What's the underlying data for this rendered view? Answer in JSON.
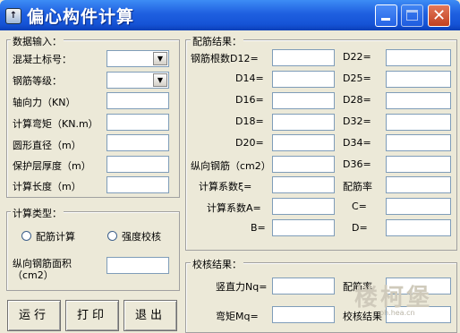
{
  "window": {
    "title": "偏心构件计算",
    "icon": "app-icon"
  },
  "input": {
    "legend": "数据输入：",
    "concrete_label": "混凝土标号：",
    "steel_label": "钢筋等级：",
    "axial_label": "轴向力（KN）",
    "moment_label": "计算弯矩（KN.m）",
    "diameter_label": "圆形直径（m）",
    "cover_label": "保护层厚度（m）",
    "length_label": "计算长度（m）"
  },
  "calc_type": {
    "legend": "计算类型：",
    "option1": "配筋计算",
    "option2": "强度校核",
    "area_label_1": "纵向钢筋面积",
    "area_label_2": "（cm2）"
  },
  "rebar": {
    "legend": "配筋结果：",
    "count_label": "钢筋根数D12=",
    "d14": "D14=",
    "d16": "D16=",
    "d18": "D18=",
    "d20": "D20=",
    "d22": "D22=",
    "d25": "D25=",
    "d28": "D28=",
    "d32": "D32=",
    "d34": "D34=",
    "d36": "D36=",
    "long_rebar": "纵向钢筋（cm2）",
    "xi": "计算系数ξ=",
    "ratio": "配筋率",
    "a": "计算系数A=",
    "c": "C=",
    "b": "B=",
    "d": "D="
  },
  "check": {
    "legend": "校核结果：",
    "nq": "竖直力Nq=",
    "ratio": "配筋率",
    "mq": "弯矩Mq=",
    "result": "校核结果"
  },
  "buttons": {
    "run": "运行",
    "print": "打印",
    "exit": "退出"
  },
  "watermark": {
    "text": "楼柯堡",
    "url": "ph.hea.cn"
  }
}
